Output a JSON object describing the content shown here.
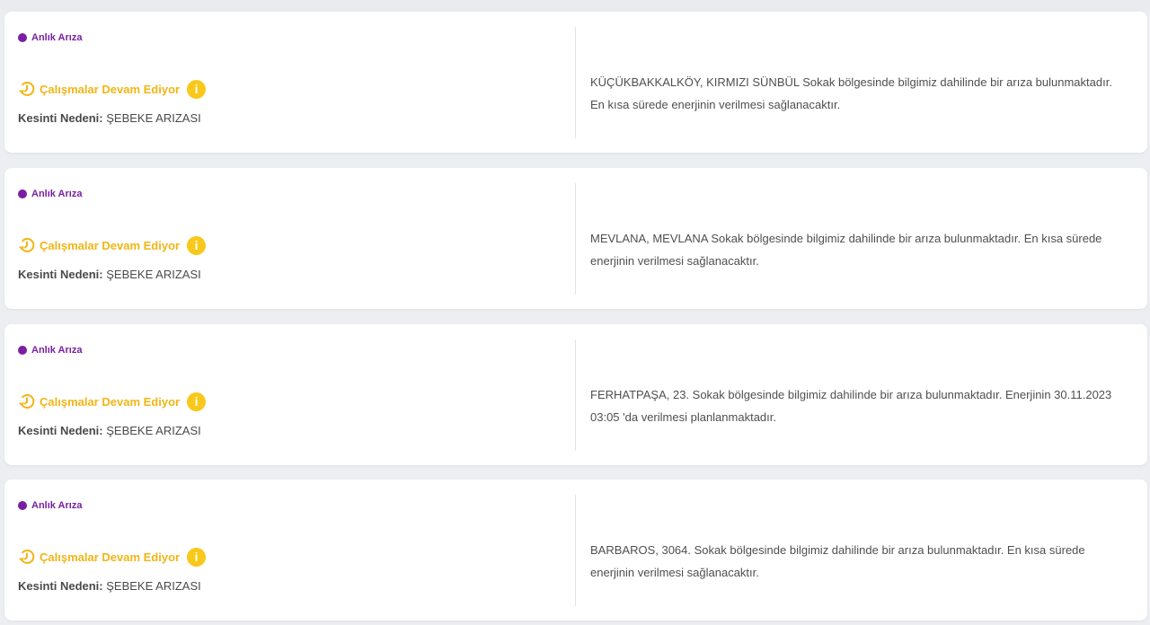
{
  "outages": [
    {
      "type_label": "Anlık Arıza",
      "status_label": "Çalışmalar Devam Ediyor",
      "cause_label": "Kesinti Nedeni:",
      "cause_value": "ŞEBEKE ARIZASI",
      "description": "KÜÇÜKBAKKALKÖY, KIRMIZI SÜNBÜL Sokak bölgesinde bilgimiz dahilinde bir arıza bulunmaktadır. En kısa sürede enerjinin verilmesi sağlanacaktır."
    },
    {
      "type_label": "Anlık Arıza",
      "status_label": "Çalışmalar Devam Ediyor",
      "cause_label": "Kesinti Nedeni:",
      "cause_value": "ŞEBEKE ARIZASI",
      "description": "MEVLANA, MEVLANA Sokak bölgesinde bilgimiz dahilinde bir arıza bulunmaktadır. En kısa sürede enerjinin verilmesi sağlanacaktır."
    },
    {
      "type_label": "Anlık Arıza",
      "status_label": "Çalışmalar Devam Ediyor",
      "cause_label": "Kesinti Nedeni:",
      "cause_value": "ŞEBEKE ARIZASI",
      "description": "FERHATPAŞA, 23. Sokak bölgesinde bilgimiz dahilinde bir arıza bulunmaktadır. Enerjinin 30.11.2023 03:05 'da verilmesi planlanmaktadır."
    },
    {
      "type_label": "Anlık Arıza",
      "status_label": "Çalışmalar Devam Ediyor",
      "cause_label": "Kesinti Nedeni:",
      "cause_value": "ŞEBEKE ARIZASI",
      "description": "BARBAROS, 3064. Sokak bölgesinde bilgimiz dahilinde bir arıza bulunmaktadır. En kısa sürede enerjinin verilmesi sağlanacaktır."
    }
  ],
  "icons": {
    "status": "clock-history-icon",
    "info": "info-icon",
    "info_glyph": "i"
  },
  "colors": {
    "badge": "#7a1fa2",
    "status": "#f2b516",
    "info": "#f8c81b"
  }
}
